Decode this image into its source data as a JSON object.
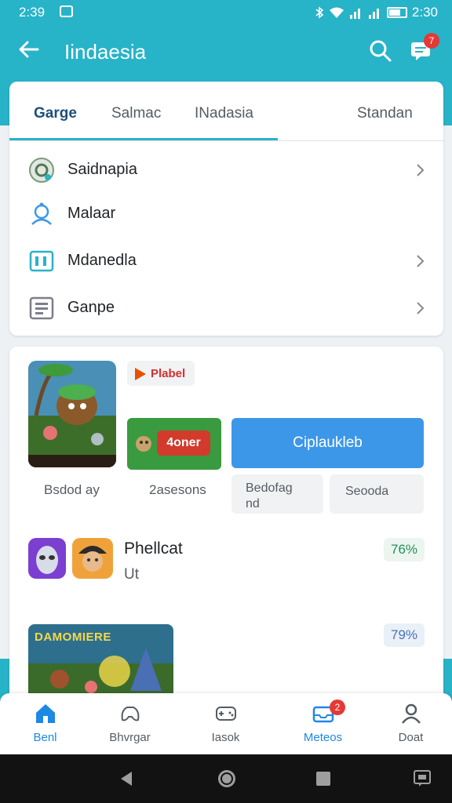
{
  "status_bar": {
    "time_left": "2:39",
    "time_right": "2:30"
  },
  "app_bar": {
    "title": "Iindaesia",
    "notification_count": "7"
  },
  "tabs": [
    {
      "label": "Garge",
      "active": true
    },
    {
      "label": "Salmac",
      "active": false
    },
    {
      "label": "INadasia",
      "active": false
    },
    {
      "label": "Standan",
      "active": false
    }
  ],
  "menu_rows": [
    {
      "label": "Saidnapia",
      "icon": "settings-circle-icon",
      "has_chevron": true
    },
    {
      "label": "Malaar",
      "icon": "map-pin-icon",
      "has_chevron": false
    },
    {
      "label": "Mdanedla",
      "icon": "media-icon",
      "has_chevron": true
    },
    {
      "label": "Ganpe",
      "icon": "document-icon",
      "has_chevron": true
    }
  ],
  "game_section": {
    "play_chip": "Plabel",
    "promo_button": "4oner",
    "action_button": "Ciplaukleb",
    "caption_left": "Bsdod ay",
    "caption_mid": "2asesons",
    "chip_a_line1": "Bedofag",
    "chip_a_line2": "nd",
    "chip_b": "Seooda"
  },
  "entry": {
    "title": "Phellcat",
    "subtitle": "Ut",
    "percent": "76%"
  },
  "banner": {
    "title": "DAMOMIERE",
    "percent": "79%"
  },
  "bottom_nav": [
    {
      "label": "Benl",
      "icon": "home-icon",
      "active": true
    },
    {
      "label": "Bhvrgar",
      "icon": "game-controller-icon",
      "active": false
    },
    {
      "label": "Iasok",
      "icon": "controller-icon",
      "active": false
    },
    {
      "label": "Meteos",
      "icon": "inbox-icon",
      "active": true,
      "badge": "2"
    },
    {
      "label": "Doat",
      "icon": "profile-icon",
      "active": false
    }
  ],
  "colors": {
    "accent": "#27b3c8",
    "primary_blue": "#3d97e8",
    "badge_red": "#e53935"
  }
}
